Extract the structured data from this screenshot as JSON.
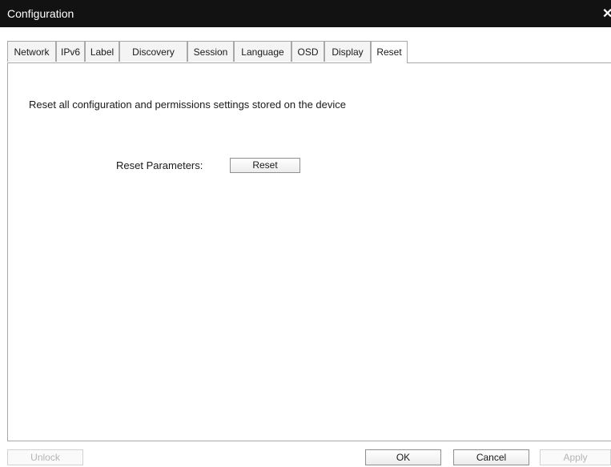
{
  "window": {
    "title": "Configuration",
    "close_glyph": "✕",
    "close_icon": "close-icon"
  },
  "tabs": [
    {
      "label": "Network"
    },
    {
      "label": "IPv6"
    },
    {
      "label": "Label"
    },
    {
      "label": "Discovery"
    },
    {
      "label": "Session"
    },
    {
      "label": "Language"
    },
    {
      "label": "OSD"
    },
    {
      "label": "Display"
    },
    {
      "label": "Reset",
      "active": true
    }
  ],
  "reset_page": {
    "description": "Reset all configuration and permissions settings stored on the device",
    "parameters_label": "Reset Parameters:",
    "reset_button_label": "Reset"
  },
  "footer": {
    "unlock_label": "Unlock",
    "ok_label": "OK",
    "cancel_label": "Cancel",
    "apply_label": "Apply"
  }
}
